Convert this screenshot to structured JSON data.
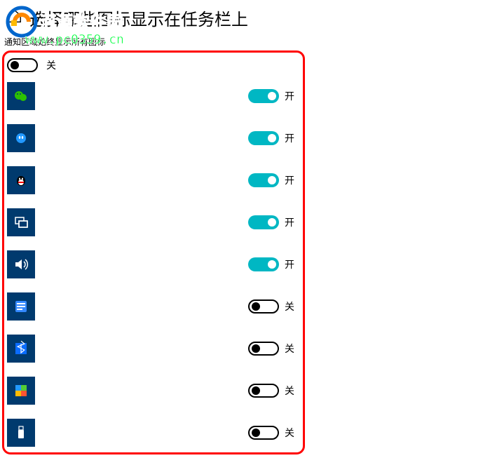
{
  "header": {
    "title": "选择哪些图标显示在任务栏上"
  },
  "subtitle": "通知区域始终显示所有图标",
  "watermark": {
    "text_top": "河源软件园",
    "text_bottom": "www.pc0359.cn"
  },
  "master_toggle": {
    "state": "off",
    "label": "关"
  },
  "toggle_labels": {
    "on": "开",
    "off": "关"
  },
  "apps": [
    {
      "icon": "wechat-icon",
      "state": "on"
    },
    {
      "icon": "baidu-icon",
      "state": "on"
    },
    {
      "icon": "qq-icon",
      "state": "on"
    },
    {
      "icon": "network-icon",
      "state": "on"
    },
    {
      "icon": "volume-icon",
      "state": "on"
    },
    {
      "icon": "system-icon",
      "state": "off"
    },
    {
      "icon": "bluetooth-icon",
      "state": "off"
    },
    {
      "icon": "defender-icon",
      "state": "off"
    },
    {
      "icon": "usb-icon",
      "state": "off"
    }
  ]
}
